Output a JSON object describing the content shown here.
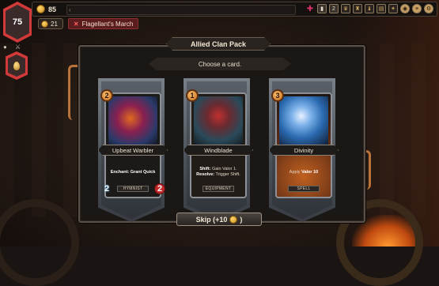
{
  "hud": {
    "health": "75",
    "gold": "85",
    "embers": "21",
    "ring_name": "Flagellant's March",
    "covenant_level": "2"
  },
  "reward": {
    "title": "Allied Clan Pack",
    "prompt": "Choose a card.",
    "skip_label": "Skip (+10",
    "skip_suffix": ")"
  },
  "cards": [
    {
      "name": "Upbeat Warbler",
      "cost": "2",
      "type": "HYMNIST",
      "desc_key": "Enchant:",
      "desc_val": "Grant Quick",
      "desc_key2": "",
      "desc_val2": "",
      "attack": "2",
      "health": "2"
    },
    {
      "name": "Windblade",
      "cost": "1",
      "type": "EQUIPMENT",
      "desc_key": "Shift:",
      "desc_val": "Gain Valor 1.",
      "desc_key2": "Resolve:",
      "desc_val2": "Trigger Shift."
    },
    {
      "name": "Divinity",
      "cost": "3",
      "type": "SPELL",
      "desc_key": "Apply",
      "desc_val": "Valor 10",
      "desc_key2": "",
      "desc_val2": ""
    }
  ],
  "colors": {
    "accent_red": "#d23a3a",
    "gold": "#c8891c",
    "pipe": "#b8733a"
  }
}
